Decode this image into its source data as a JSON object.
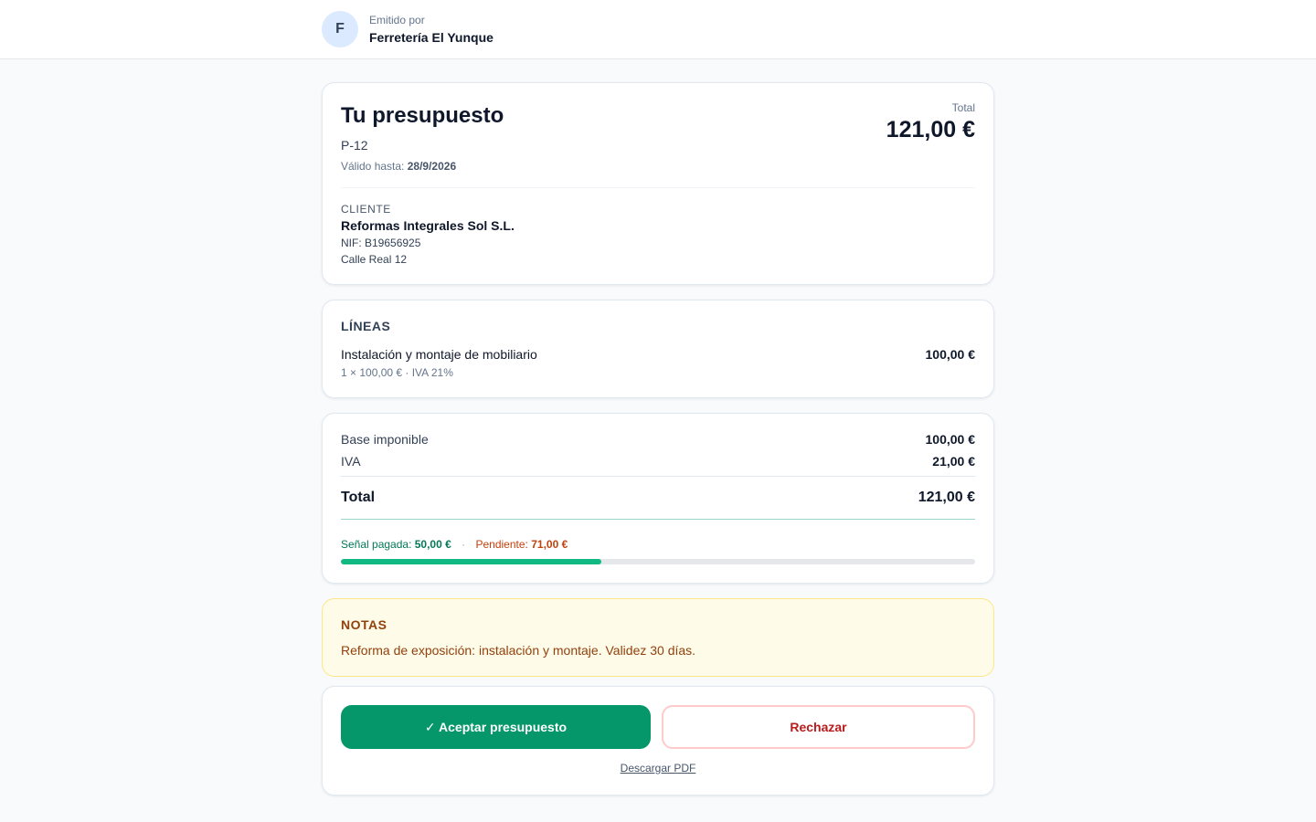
{
  "issuer": {
    "avatar_letter": "F",
    "label": "Emitido por",
    "name": "Ferretería El Yunque"
  },
  "quote": {
    "title": "Tu presupuesto",
    "number": "P-12",
    "valid_label": "Válido hasta:",
    "valid_date": "28/9/2026",
    "total_label": "Total",
    "total_value": "121,00 €"
  },
  "client": {
    "caption": "CLIENTE",
    "name": "Reformas Integrales Sol S.L.",
    "nif": "NIF: B19656925",
    "address": "Calle Real 12"
  },
  "lines": {
    "title": "LÍNEAS",
    "items": [
      {
        "description": "Instalación y montaje de mobiliario",
        "meta": "1 × 100,00 € · IVA 21%",
        "amount": "100,00 €"
      }
    ]
  },
  "totals": {
    "base_label": "Base imponible",
    "base_value": "100,00 €",
    "iva_label": "IVA",
    "iva_value": "21,00 €",
    "total_label": "Total",
    "total_value": "121,00 €",
    "paid_label": "Señal pagada:",
    "paid_value": "50,00 €",
    "separator": "·",
    "pending_label": "Pendiente:",
    "pending_value": "71,00 €",
    "paid_fraction": 0.41
  },
  "notes": {
    "title": "NOTAS",
    "text": "Reforma de exposición: instalación y montaje. Validez 30 días."
  },
  "actions": {
    "accept_label": "✓ Aceptar presupuesto",
    "reject_label": "Rechazar",
    "pdf_label": "Descargar PDF"
  },
  "colors": {
    "accent_green": "#059669",
    "progress_green": "#10b981",
    "pending_orange": "#c2410c",
    "notes_bg": "#fefce8"
  }
}
